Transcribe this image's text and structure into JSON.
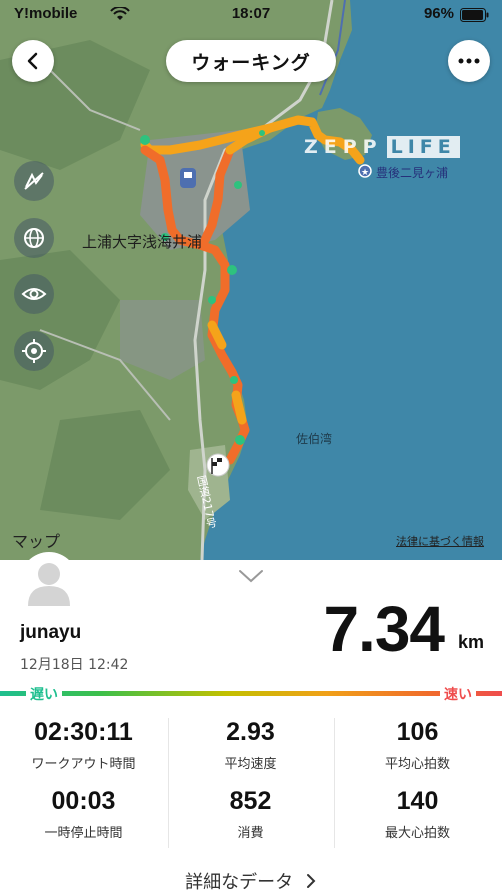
{
  "status_bar": {
    "carrier": "Y!mobile",
    "time": "18:07",
    "battery": "96%"
  },
  "header": {
    "title": "ウォーキング",
    "back_icon": "chevron-left-icon",
    "more_icon": "ellipsis-icon"
  },
  "map": {
    "place_labels": {
      "town": "上浦大字浅海井浦",
      "poi": "豊後二見ヶ浦",
      "bay": "佐伯湾",
      "road": "国道217号"
    },
    "logo_zepp": "ZEPP",
    "logo_life": "LIFE",
    "attribution_maps": "マップ",
    "attribution_legal": "法律に基づく情報",
    "side_controls": [
      "layers-off-icon",
      "globe-icon",
      "eye-icon",
      "locate-icon"
    ],
    "colors": {
      "water": "#3f87a8",
      "land": "#7c9a6a",
      "route_fast": "#f06d2a",
      "route_mid": "#f5a31a",
      "route_slow": "#2ec27e"
    }
  },
  "summary": {
    "username": "junayu",
    "datetime": "12月18日 12:42",
    "distance": "7.34",
    "distance_unit": "km",
    "speed_scale": {
      "slow": "遅い",
      "fast": "速い"
    }
  },
  "stats": [
    {
      "value": "02:30:11",
      "label": "ワークアウト時間"
    },
    {
      "value": "2.93",
      "label": "平均速度"
    },
    {
      "value": "106",
      "label": "平均心拍数"
    },
    {
      "value": "00:03",
      "label": "一時停止時間"
    },
    {
      "value": "852",
      "label": "消費"
    },
    {
      "value": "140",
      "label": "最大心拍数"
    }
  ],
  "footer": {
    "detail_link": "詳細なデータ"
  }
}
